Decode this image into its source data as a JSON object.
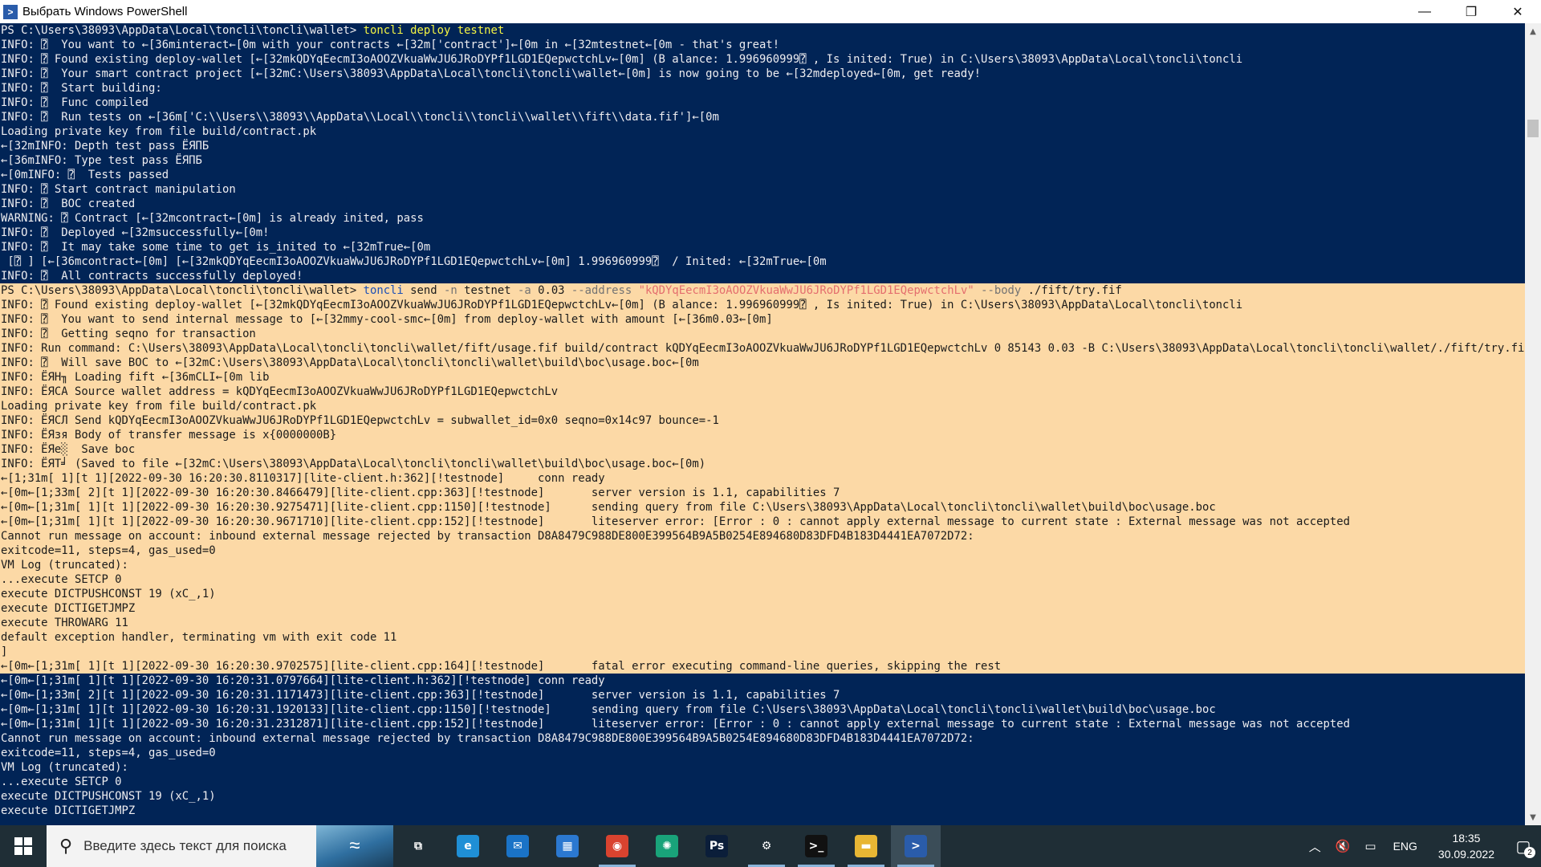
{
  "window": {
    "title": "Выбрать Windows PowerShell",
    "icon": "powershell-icon",
    "controls": [
      "—",
      "❐",
      "✕"
    ]
  },
  "console": {
    "lines": [
      {
        "sel": false,
        "segs": [
          {
            "t": "PS C:\\Users\\38093\\AppData\\Local\\toncli\\toncli\\wallet> "
          },
          {
            "t": "toncli",
            "c": "y"
          },
          {
            "t": " deploy testnet",
            "c": "y"
          }
        ]
      },
      {
        "sel": false,
        "segs": [
          {
            "t": "INFO: ⍰  You want to ←[36minteract←[0m with your contracts ←[32m['contract']←[0m in ←[32mtestnet←[0m - that's great!"
          }
        ]
      },
      {
        "sel": false,
        "segs": [
          {
            "t": "INFO: ⍰ Found existing deploy-wallet [←[32mkQDYqEecmI3oAOOZVkuaWwJU6JRoDYPf1LGD1EQepwctchLv←[0m] (B alance: 1.996960999⍰ , Is inited: True) in C:\\Users\\38093\\AppData\\Local\\toncli\\toncli"
          }
        ]
      },
      {
        "sel": false,
        "segs": [
          {
            "t": "INFO: ⍰  Your smart contract project [←[32mC:\\Users\\38093\\AppData\\Local\\toncli\\toncli\\wallet←[0m] is now going to be ←[32mdeployed←[0m, get ready!"
          }
        ]
      },
      {
        "sel": false,
        "segs": [
          {
            "t": "INFO: ⍰  Start building:"
          }
        ]
      },
      {
        "sel": false,
        "segs": [
          {
            "t": "INFO: ⍰  Func compiled"
          }
        ]
      },
      {
        "sel": false,
        "segs": [
          {
            "t": "INFO: ⍰  Run tests on ←[36m['C:\\\\Users\\\\38093\\\\AppData\\\\Local\\\\toncli\\\\toncli\\\\wallet\\\\fift\\\\data.fif']←[0m"
          }
        ]
      },
      {
        "sel": false,
        "segs": [
          {
            "t": "Loading private key from file build/contract.pk"
          }
        ]
      },
      {
        "sel": false,
        "segs": [
          {
            "t": "←[32mINFO: Depth test pass ЁЯПБ"
          }
        ]
      },
      {
        "sel": false,
        "segs": [
          {
            "t": "←[36mINFO: Type test pass ЁЯПБ"
          }
        ]
      },
      {
        "sel": false,
        "segs": [
          {
            "t": "←[0mINFO: ⍰  Tests passed"
          }
        ]
      },
      {
        "sel": false,
        "segs": [
          {
            "t": "INFO: ⍰ Start contract manipulation"
          }
        ]
      },
      {
        "sel": false,
        "segs": [
          {
            "t": "INFO: ⍰  BOC created"
          }
        ]
      },
      {
        "sel": false,
        "segs": [
          {
            "t": "WARNING: ⍰ Contract [←[32mcontract←[0m] is already inited, pass"
          }
        ]
      },
      {
        "sel": false,
        "segs": [
          {
            "t": "INFO: ⍰  Deployed ←[32msuccessfully←[0m!"
          }
        ]
      },
      {
        "sel": false,
        "segs": [
          {
            "t": "INFO: ⍰  It may take some time to get is_inited to ←[32mTrue←[0m"
          }
        ]
      },
      {
        "sel": false,
        "segs": [
          {
            "t": " [⍰ ] [←[36mcontract←[0m] [←[32mkQDYqEecmI3oAOOZVkuaWwJU6JRoDYPf1LGD1EQepwctchLv←[0m] 1.996960999⍰  / Inited: ←[32mTrue←[0m"
          }
        ]
      },
      {
        "sel": false,
        "segs": [
          {
            "t": "INFO: ⍰  All contracts successfully deployed!"
          }
        ]
      },
      {
        "sel": true,
        "segs": [
          {
            "t": "PS C:\\Users\\38093\\AppData\\Local\\toncli\\toncli\\wallet> "
          },
          {
            "t": "toncli",
            "c": "cmd"
          },
          {
            "t": " send "
          },
          {
            "t": "-n",
            "c": "gray"
          },
          {
            "t": " testnet "
          },
          {
            "t": "-a",
            "c": "gray"
          },
          {
            "t": " 0.03 "
          },
          {
            "t": "--address",
            "c": "gray"
          },
          {
            "t": " "
          },
          {
            "t": "\"kQDYqEecmI3oAOOZVkuaWwJU6JRoDYPf1LGD1EQepwctchLv\"",
            "c": "str"
          },
          {
            "t": " "
          },
          {
            "t": "--body",
            "c": "gray"
          },
          {
            "t": " ./fift/try.fif"
          }
        ]
      },
      {
        "sel": true,
        "segs": [
          {
            "t": "INFO: ⍰ Found existing deploy-wallet [←[32mkQDYqEecmI3oAOOZVkuaWwJU6JRoDYPf1LGD1EQepwctchLv←[0m] (B alance: 1.996960999⍰ , Is inited: True) in C:\\Users\\38093\\AppData\\Local\\toncli\\toncli"
          }
        ]
      },
      {
        "sel": true,
        "segs": [
          {
            "t": "INFO: ⍰  You want to send internal message to [←[32mmy-cool-smc←[0m] from deploy-wallet with amount [←[36m0.03←[0m]"
          }
        ]
      },
      {
        "sel": true,
        "segs": [
          {
            "t": "INFO: ⍰  Getting seqno for transaction"
          }
        ]
      },
      {
        "sel": true,
        "segs": [
          {
            "t": "INFO: Run command: C:\\Users\\38093\\AppData\\Local\\toncli\\toncli\\wallet/fift/usage.fif build/contract kQDYqEecmI3oAOOZVkuaWwJU6JRoDYPf1LGD1EQepwctchLv 0 85143 0.03 -B C:\\Users\\38093\\AppData\\Local\\toncli\\toncli\\wallet/./fift/try.fif"
          }
        ]
      },
      {
        "sel": true,
        "segs": [
          {
            "t": "INFO: ⍰  Will save BOC to ←[32mC:\\Users\\38093\\AppData\\Local\\toncli\\toncli\\wallet\\build\\boc\\usage.boc←[0m"
          }
        ]
      },
      {
        "sel": true,
        "segs": [
          {
            "t": "INFO: ЁЯН╖ Loading fift ←[36mCLI←[0m lib"
          }
        ]
      },
      {
        "sel": true,
        "segs": [
          {
            "t": "INFO: ЁЯСА Source wallet address = kQDYqEecmI3oAOOZVkuaWwJU6JRoDYPf1LGD1EQepwctchLv"
          }
        ]
      },
      {
        "sel": true,
        "segs": [
          {
            "t": "Loading private key from file build/contract.pk"
          }
        ]
      },
      {
        "sel": true,
        "segs": [
          {
            "t": "INFO: ЁЯСЛ Send kQDYqEecmI3oAOOZVkuaWwJU6JRoDYPf1LGD1EQepwctchLv = subwallet_id=0x0 seqno=0x14c97 bounce=-1"
          }
        ]
      },
      {
        "sel": true,
        "segs": [
          {
            "t": "INFO: ЁЯзя Body of transfer message is x{0000000B}"
          }
        ]
      },
      {
        "sel": true,
        "segs": [
          {
            "t": "INFO: ЁЯе░  Save boc"
          }
        ]
      },
      {
        "sel": true,
        "segs": [
          {
            "t": "INFO: ЁЯТ╛ (Saved to file ←[32mC:\\Users\\38093\\AppData\\Local\\toncli\\toncli\\wallet\\build\\boc\\usage.boc←[0m)"
          }
        ]
      },
      {
        "sel": true,
        "segs": [
          {
            "t": "←[1;31m[ 1][t 1][2022-09-30 16:20:30.8110317][lite-client.h:362][!testnode]     conn ready"
          }
        ]
      },
      {
        "sel": true,
        "segs": [
          {
            "t": "←[0m←[1;33m[ 2][t 1][2022-09-30 16:20:30.8466479][lite-client.cpp:363][!testnode]       server version is 1.1, capabilities 7"
          }
        ]
      },
      {
        "sel": true,
        "segs": [
          {
            "t": "←[0m←[1;31m[ 1][t 1][2022-09-30 16:20:30.9275471][lite-client.cpp:1150][!testnode]      sending query from file C:\\Users\\38093\\AppData\\Local\\toncli\\toncli\\wallet\\build\\boc\\usage.boc"
          }
        ]
      },
      {
        "sel": true,
        "segs": [
          {
            "t": "←[0m←[1;31m[ 1][t 1][2022-09-30 16:20:30.9671710][lite-client.cpp:152][!testnode]       liteserver error: [Error : 0 : cannot apply external message to current state : External message was not accepted"
          }
        ]
      },
      {
        "sel": true,
        "segs": [
          {
            "t": "Cannot run message on account: inbound external message rejected by transaction D8A8479C988DE800E399564B9A5B0254E894680D83DFD4B183D4441EA7072D72:"
          }
        ]
      },
      {
        "sel": true,
        "segs": [
          {
            "t": "exitcode=11, steps=4, gas_used=0"
          }
        ]
      },
      {
        "sel": true,
        "segs": [
          {
            "t": "VM Log (truncated):"
          }
        ]
      },
      {
        "sel": true,
        "segs": [
          {
            "t": "...execute SETCP 0"
          }
        ]
      },
      {
        "sel": true,
        "segs": [
          {
            "t": "execute DICTPUSHCONST 19 (xC_,1)"
          }
        ]
      },
      {
        "sel": true,
        "segs": [
          {
            "t": "execute DICTIGETJMPZ"
          }
        ]
      },
      {
        "sel": true,
        "segs": [
          {
            "t": "execute THROWARG 11"
          }
        ]
      },
      {
        "sel": true,
        "segs": [
          {
            "t": "default exception handler, terminating vm with exit code 11"
          }
        ]
      },
      {
        "sel": true,
        "segs": [
          {
            "t": "]"
          }
        ]
      },
      {
        "sel": true,
        "segs": [
          {
            "t": "←[0m←[1;31m[ 1][t 1][2022-09-30 16:20:30.9702575][lite-client.cpp:164][!testnode]       fatal error executing command-line queries, skipping the rest"
          }
        ]
      },
      {
        "sel": false,
        "segs": [
          {
            "t": "←[0m←[1;31m[ 1][t 1][2022-09-30 16:20:31.0797664][lite-client.h:362][!testnode] conn ready"
          }
        ]
      },
      {
        "sel": false,
        "segs": [
          {
            "t": "←[0m←[1;33m[ 2][t 1][2022-09-30 16:20:31.1171473][lite-client.cpp:363][!testnode]       server version is 1.1, capabilities 7"
          }
        ]
      },
      {
        "sel": false,
        "segs": [
          {
            "t": "←[0m←[1;31m[ 1][t 1][2022-09-30 16:20:31.1920133][lite-client.cpp:1150][!testnode]      sending query from file C:\\Users\\38093\\AppData\\Local\\toncli\\toncli\\wallet\\build\\boc\\usage.boc"
          }
        ]
      },
      {
        "sel": false,
        "segs": [
          {
            "t": "←[0m←[1;31m[ 1][t 1][2022-09-30 16:20:31.2312871][lite-client.cpp:152][!testnode]       liteserver error: [Error : 0 : cannot apply external message to current state : External message was not accepted"
          }
        ]
      },
      {
        "sel": false,
        "segs": [
          {
            "t": "Cannot run message on account: inbound external message rejected by transaction D8A8479C988DE800E399564B9A5B0254E894680D83DFD4B183D4441EA7072D72:"
          }
        ]
      },
      {
        "sel": false,
        "segs": [
          {
            "t": "exitcode=11, steps=4, gas_used=0"
          }
        ]
      },
      {
        "sel": false,
        "segs": [
          {
            "t": "VM Log (truncated):"
          }
        ]
      },
      {
        "sel": false,
        "segs": [
          {
            "t": "...execute SETCP 0"
          }
        ]
      },
      {
        "sel": false,
        "segs": [
          {
            "t": "execute DICTPUSHCONST 19 (xC_,1)"
          }
        ]
      },
      {
        "sel": false,
        "segs": [
          {
            "t": "execute DICTIGETJMPZ"
          }
        ]
      }
    ]
  },
  "taskbar": {
    "search_placeholder": "Введите здесь текст для поиска",
    "apps": [
      {
        "name": "task-view-icon",
        "glyph": "⧉",
        "bg": "",
        "running": false,
        "active": false
      },
      {
        "name": "edge-icon",
        "glyph": "e",
        "bg": "#1f8fd6",
        "running": false,
        "active": false
      },
      {
        "name": "mail-icon",
        "glyph": "✉",
        "bg": "#1a73c7",
        "running": false,
        "active": false
      },
      {
        "name": "store-icon",
        "glyph": "▦",
        "bg": "#2b78d0",
        "running": false,
        "active": false
      },
      {
        "name": "chrome-icon",
        "glyph": "◉",
        "bg": "#d9432f",
        "running": true,
        "active": false
      },
      {
        "name": "chatgpt-icon",
        "glyph": "✺",
        "bg": "#19a37a",
        "running": false,
        "active": false
      },
      {
        "name": "photoshop-icon",
        "glyph": "Ps",
        "bg": "#0b1e3a",
        "running": false,
        "active": false
      },
      {
        "name": "settings-icon",
        "glyph": "⚙",
        "bg": "",
        "running": true,
        "active": false
      },
      {
        "name": "terminal-icon",
        "glyph": ">_",
        "bg": "#111111",
        "running": true,
        "active": false
      },
      {
        "name": "explorer-icon",
        "glyph": "▬",
        "bg": "#e8b634",
        "running": true,
        "active": false
      },
      {
        "name": "powershell-icon",
        "glyph": ">",
        "bg": "#2a5caa",
        "running": true,
        "active": true
      }
    ],
    "tray": {
      "lang": "ENG",
      "time": "18:35",
      "date": "30.09.2022",
      "notifications": "2"
    }
  },
  "colors": {
    "console_bg": "#012456",
    "selection_bg": "#fcd9a6",
    "command_yellow": "#f5f543"
  }
}
